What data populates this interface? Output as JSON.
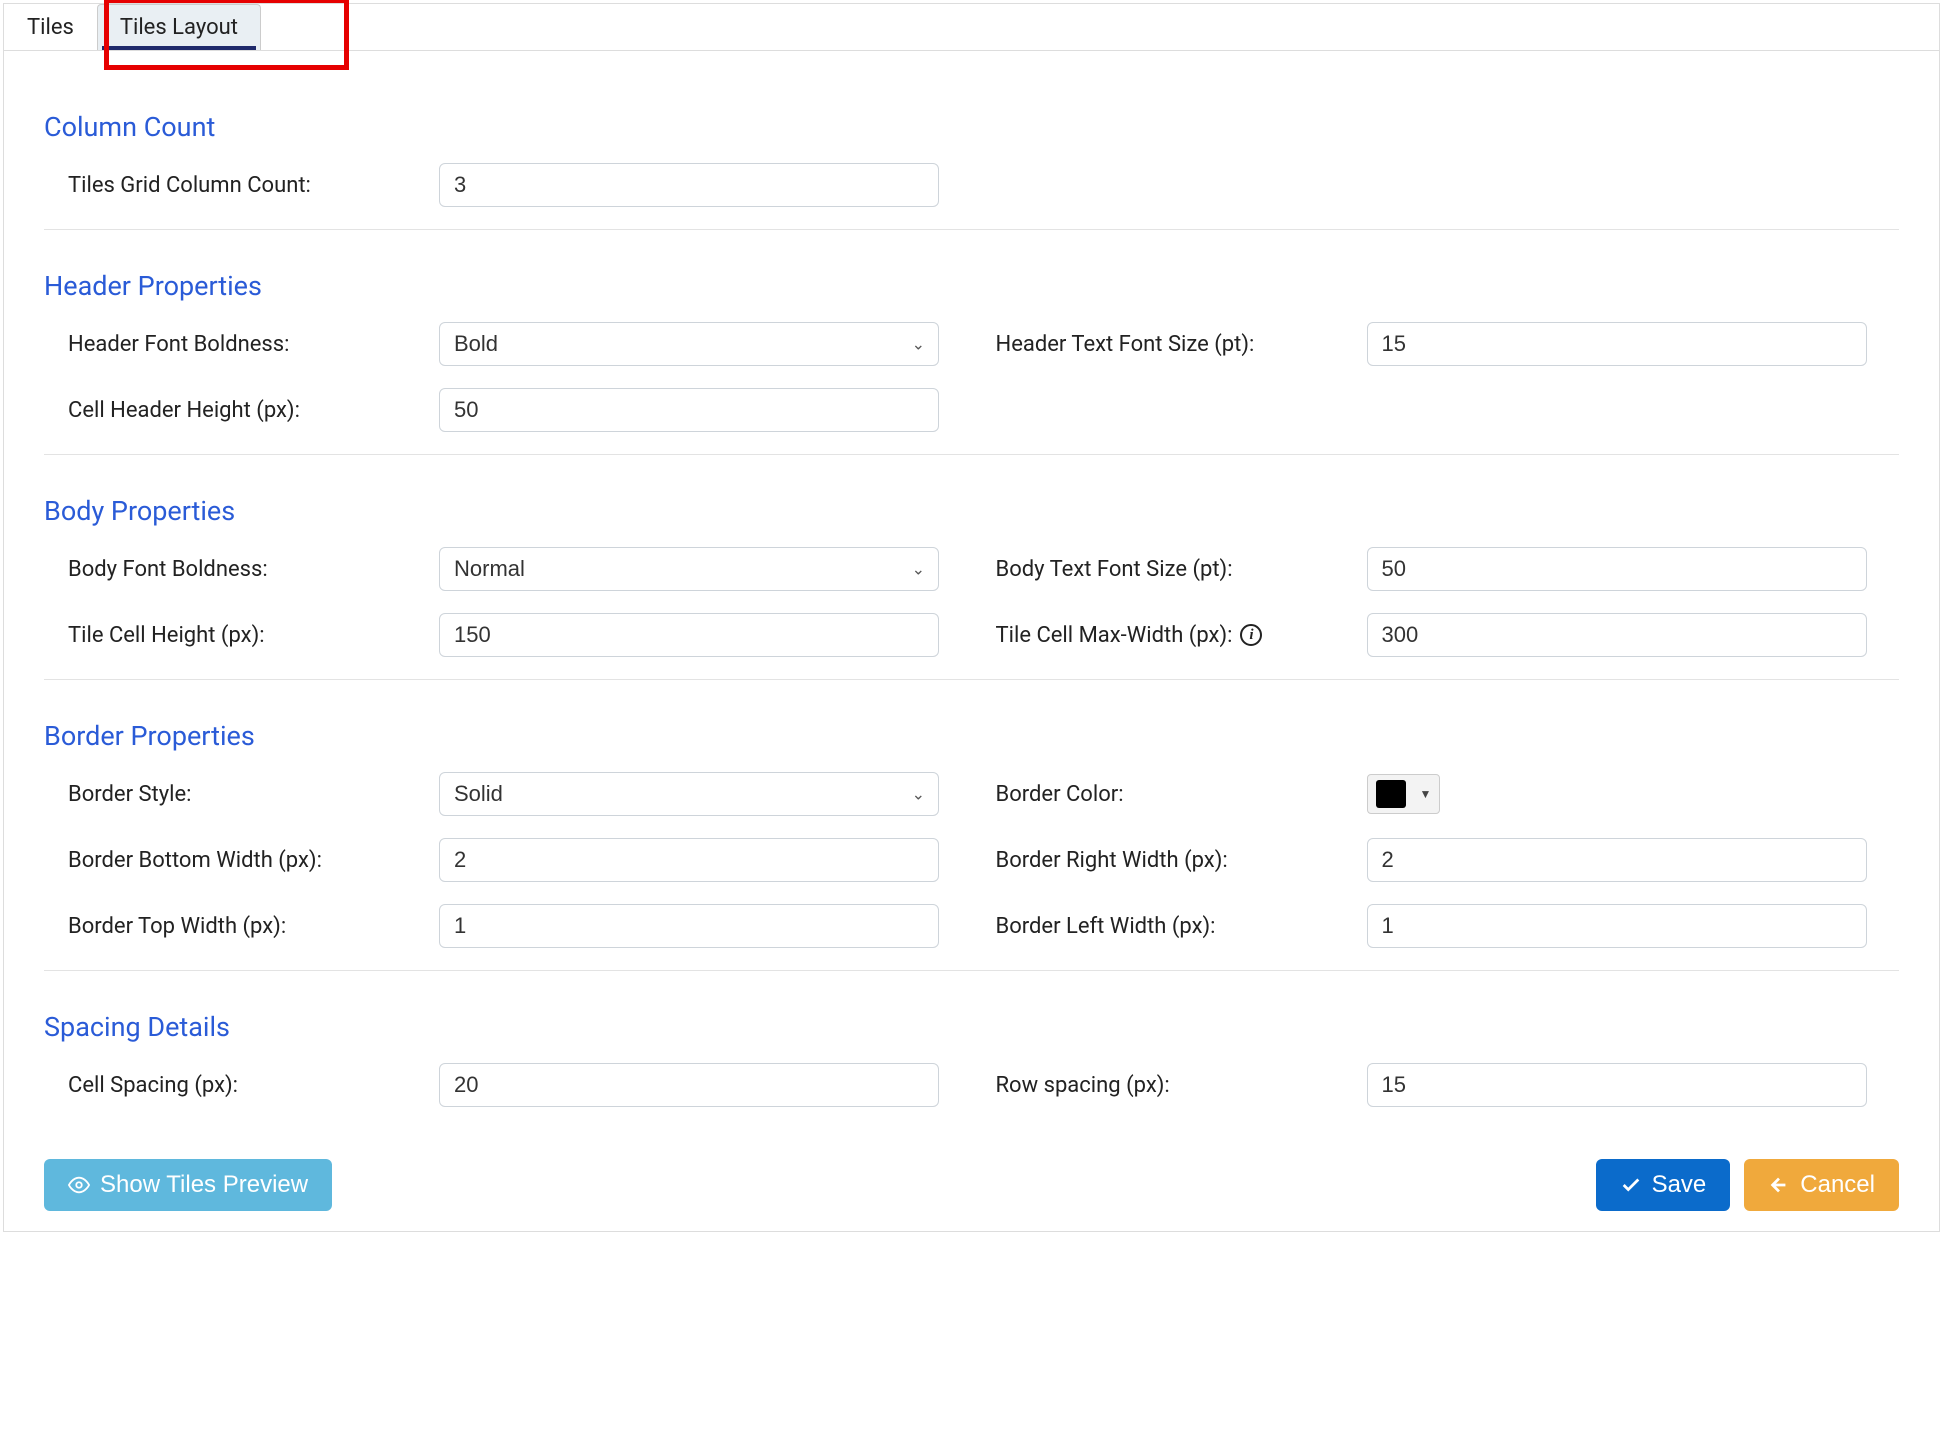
{
  "tabs": {
    "tiles": "Tiles",
    "tiles_layout": "Tiles Layout"
  },
  "sections": {
    "column_count": {
      "title": "Column Count",
      "grid_col_label": "Tiles Grid Column Count:",
      "grid_col_value": "3"
    },
    "header_props": {
      "title": "Header Properties",
      "boldness_label": "Header Font Boldness:",
      "boldness_value": "Bold",
      "font_size_label": "Header Text Font Size (pt):",
      "font_size_value": "15",
      "cell_height_label": "Cell Header Height (px):",
      "cell_height_value": "50"
    },
    "body_props": {
      "title": "Body Properties",
      "boldness_label": "Body Font Boldness:",
      "boldness_value": "Normal",
      "font_size_label": "Body Text Font Size (pt):",
      "font_size_value": "50",
      "cell_height_label": "Tile Cell Height (px):",
      "cell_height_value": "150",
      "max_width_label": "Tile Cell Max-Width (px):",
      "max_width_value": "300"
    },
    "border_props": {
      "title": "Border Properties",
      "style_label": "Border Style:",
      "style_value": "Solid",
      "color_label": "Border Color:",
      "color_value": "#000000",
      "bottom_width_label": "Border Bottom Width (px):",
      "bottom_width_value": "2",
      "right_width_label": "Border Right Width (px):",
      "right_width_value": "2",
      "top_width_label": "Border Top Width (px):",
      "top_width_value": "1",
      "left_width_label": "Border Left Width (px):",
      "left_width_value": "1"
    },
    "spacing": {
      "title": "Spacing Details",
      "cell_spacing_label": "Cell Spacing (px):",
      "cell_spacing_value": "20",
      "row_spacing_label": "Row spacing (px):",
      "row_spacing_value": "15"
    }
  },
  "buttons": {
    "preview": "Show Tiles Preview",
    "save": "Save",
    "cancel": "Cancel"
  }
}
